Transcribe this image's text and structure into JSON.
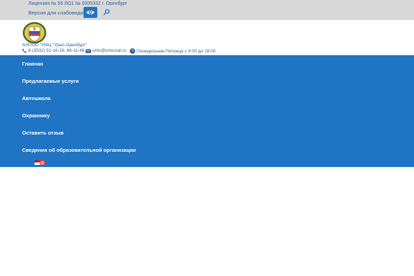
{
  "topbar": {
    "license": "Лицензия № 56 ЛО1 № 0005332 г. Оренбург",
    "accessibility_link": "Версия для слабовидящих"
  },
  "header": {
    "org_name": "АНПОО \"УМЦ \"Урал-Оренбург\"",
    "phone": "8 (3532) 51-16-16, 66-11-48",
    "email": "umc@umcural.ru",
    "hours": "Понедельник-Пятница с 9:00 до 18:00"
  },
  "nav": {
    "items": [
      {
        "label": "Главная"
      },
      {
        "label": "Предлагаемые услуги"
      },
      {
        "label": "Автошкола"
      },
      {
        "label": "Охраннику"
      },
      {
        "label": "Оставить отзыв"
      },
      {
        "label": "Сведения об образовательной организации"
      }
    ]
  },
  "icons": {
    "eye": "eye-icon",
    "search": "search-icon",
    "phone": "phone-icon",
    "email": "envelope-icon",
    "hours": "clock-icon",
    "logo": "coat-of-arms-logo",
    "language": "language-flags-icon"
  },
  "colors": {
    "topbar_bg": "#d9d9d9",
    "nav_bg": "#1f74c4",
    "link_text": "#2a5f9e",
    "nav_text": "#ffffff"
  }
}
